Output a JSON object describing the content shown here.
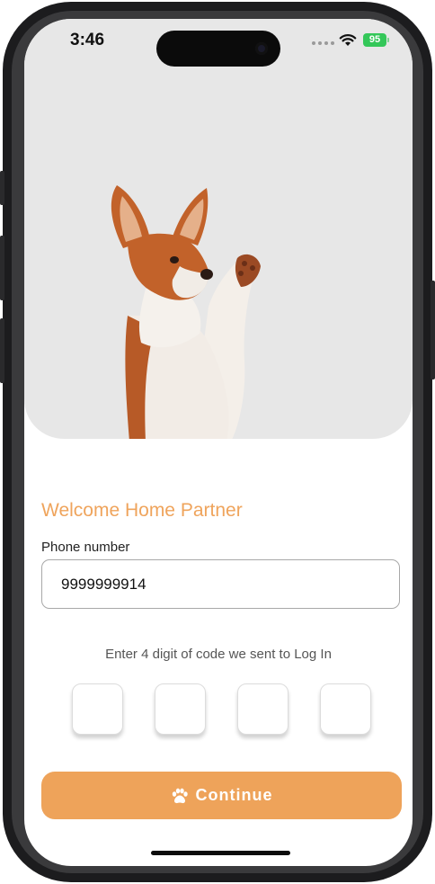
{
  "status_bar": {
    "time": "3:46",
    "battery": "95"
  },
  "login": {
    "welcome_title": "Welcome Home Partner",
    "phone_label": "Phone number",
    "phone_value": "9999999914",
    "code_hint": "Enter 4 digit of code we sent to Log In",
    "otp_digits": [
      "",
      "",
      "",
      ""
    ],
    "continue_label": "Continue"
  },
  "colors": {
    "accent": "#EEA35A",
    "hero_background": "#E7E7E7"
  },
  "icons": [
    "wifi-icon",
    "battery-icon",
    "paw-icon"
  ]
}
